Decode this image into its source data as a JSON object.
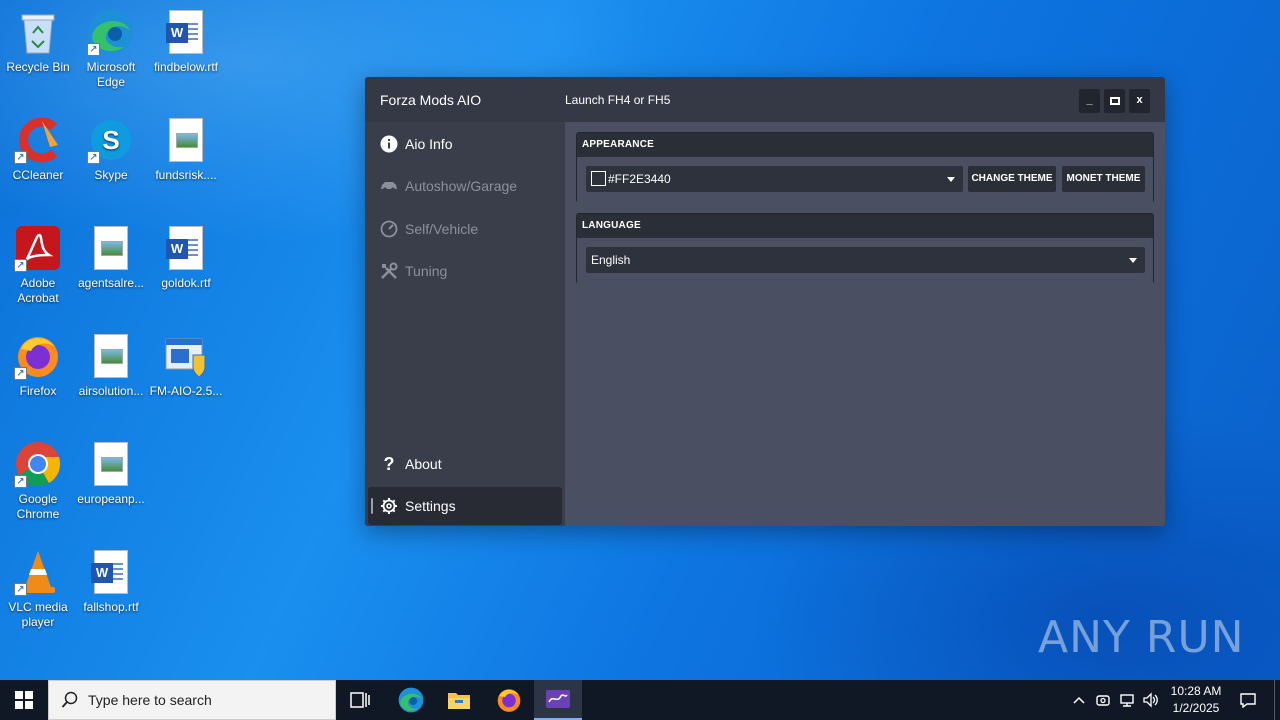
{
  "desktop": {
    "icons": [
      {
        "label": "Recycle Bin"
      },
      {
        "label": "Microsoft Edge"
      },
      {
        "label": "findbelow.rtf"
      },
      {
        "label": "CCleaner"
      },
      {
        "label": "Skype"
      },
      {
        "label": "fundsrisk...."
      },
      {
        "label": "Adobe Acrobat"
      },
      {
        "label": "agentsalre..."
      },
      {
        "label": "goldok.rtf"
      },
      {
        "label": "Firefox"
      },
      {
        "label": "airsolution..."
      },
      {
        "label": "FM-AIO-2.5..."
      },
      {
        "label": "Google Chrome"
      },
      {
        "label": "europeanp..."
      },
      {
        "label": "VLC media player"
      },
      {
        "label": "fallshop.rtf"
      }
    ]
  },
  "app": {
    "title": "Forza Mods AIO",
    "launch_text": "Launch FH4 or FH5",
    "window_buttons": {
      "minimize": "_",
      "maximize": "▫",
      "close": "x"
    },
    "nav": {
      "aio_info": "Aio Info",
      "autoshow": "Autoshow/Garage",
      "self_vehicle": "Self/Vehicle",
      "tuning": "Tuning",
      "about": "About",
      "settings": "Settings"
    },
    "appearance": {
      "header": "APPEARANCE",
      "color_value": "#FF2E3440",
      "change_theme": "CHANGE THEME",
      "monet_theme": "MONET THEME"
    },
    "language": {
      "header": "LANGUAGE",
      "value": "English"
    }
  },
  "watermark": "ANY  RUN",
  "taskbar": {
    "search_placeholder": "Type here to search",
    "time": "10:28 AM",
    "date": "1/2/2025"
  },
  "colors": {
    "app_bg": "#4a5061",
    "sidebar_bg": "#3a3e4b",
    "titlebar_bg": "#353945",
    "taskbar_bg": "#101826"
  }
}
